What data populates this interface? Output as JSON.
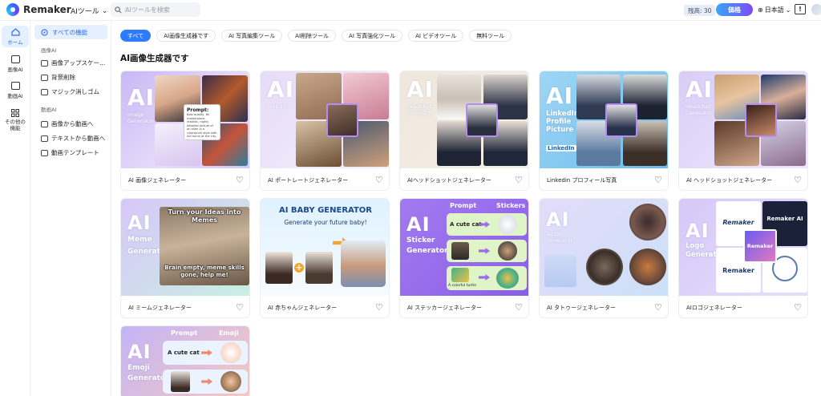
{
  "app": {
    "name": "Remaker"
  },
  "topbar": {
    "tools_label": "AIツール",
    "search_placeholder": "AIツールを検索",
    "credits": "残高: 30",
    "price_label": "価格",
    "language": "日本語"
  },
  "rail": {
    "items": [
      {
        "label": "ホーム",
        "icon": "home-icon"
      },
      {
        "label": "画像AI",
        "icon": "image-icon"
      },
      {
        "label": "動画AI",
        "icon": "video-icon"
      },
      {
        "label": "その他の機能",
        "icon": "grid-icon"
      }
    ]
  },
  "sidebar": {
    "all_label": "すべての機能",
    "image_heading": "画像AI",
    "image_items": [
      "画像アップスケー...",
      "背景削除",
      "マジック消しゴム"
    ],
    "video_heading": "動画AI",
    "video_items": [
      "画像から動画へ",
      "テキストから動画へ",
      "動画テンプレート"
    ]
  },
  "filters": [
    "すべて",
    "AI画像生成器です",
    "AI 写真編集ツール",
    "AI削除ツール",
    "AI 写真強化ツール",
    "AI ビデオツール",
    "無料ツール"
  ],
  "section_title": "AI画像生成器です",
  "cards": [
    {
      "title": "AI 画像ジェネレーター",
      "thumb_ai": "AI",
      "thumb_sub": "Image\nGenerator",
      "prompt_title": "Prompt:",
      "prompt_text": "Best quality, 8k masterpiece, realistic, highly detailed picture of an alien in a cyberpunk style with tall horns at the city, his spaceship as a tower"
    },
    {
      "title": "AI ポートレートジェネレーター",
      "thumb_ai": "AI",
      "thumb_sub": "Portrait"
    },
    {
      "title": "AIヘッドショットジェネレーター",
      "thumb_ai": "AI",
      "thumb_sub": "Headshot\nGenerator"
    },
    {
      "title": "Linkedin プロフィール写真",
      "thumb_ai": "AI",
      "thumb_sub": "LinkedIn\nProfile\nPicture",
      "badge": "LinkedIn"
    },
    {
      "title": "AI ヘッドショットジェネレーター",
      "thumb_ai": "AI",
      "thumb_sub": "Headshot\nGenerator"
    },
    {
      "title": "AI ミームジェネレーター",
      "thumb_ai": "AI",
      "thumb_sub": "Meme\nGenerator",
      "meme_top": "Turn your Ideas into Memes",
      "meme_bottom": "Brain empty, meme skills gone, help me!"
    },
    {
      "title": "AI 赤ちゃんジェネレーター",
      "heading": "AI BABY GENERATOR",
      "subheading": "Generate your future baby!"
    },
    {
      "title": "AI ステッカージェネレーター",
      "thumb_ai": "AI",
      "thumb_sub": "Sticker\nGenerator",
      "col1": "Prompt",
      "col2": "Stickers",
      "row1": "A cute cat",
      "row3": "A colorful turtle"
    },
    {
      "title": "AI タトゥージェネレーター",
      "thumb_ai": "AI",
      "thumb_sub": "Tattoo\nGenerator"
    },
    {
      "title": "AIロゴジェネレーター",
      "thumb_ai": "AI",
      "thumb_sub": "Logo\nGenerator",
      "logo1": "Remaker",
      "logo2": "Remaker AI",
      "logo3": "Remaker",
      "logo4": "Remaker"
    },
    {
      "title": "AI 絵文字ジェネレーター",
      "thumb_ai": "AI",
      "thumb_sub": "Emoji\nGenerator",
      "col1": "Prompt",
      "col2": "Emoji",
      "row1": "A cute cat"
    }
  ],
  "colors": {
    "accent": "#2f7bff",
    "active_bg": "#e5f0ff",
    "price_start": "#3aa7f5",
    "price_end": "#7b4cf5"
  }
}
